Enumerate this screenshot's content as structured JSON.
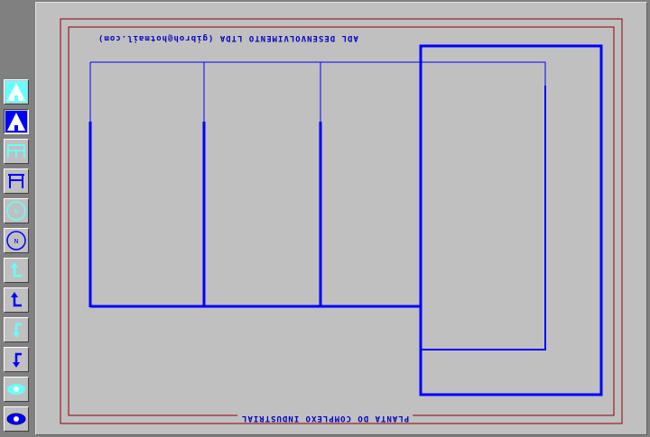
{
  "sheet": {
    "company_text": "ADL DESENVOLVIMENTO LTDA (gibroh@hotmail.com)",
    "title_text": "PLANTA DO COMPLEXO INDUSTRIAL"
  },
  "toolbar": {
    "tools": [
      {
        "name": "triangle-up-light-icon",
        "style": "light"
      },
      {
        "name": "triangle-up-dark-icon",
        "style": "dark"
      },
      {
        "name": "frame-light-icon",
        "style": "light"
      },
      {
        "name": "frame-dark-icon",
        "style": "dark"
      },
      {
        "name": "north-circle-light-icon",
        "style": "light"
      },
      {
        "name": "north-circle-dark-icon",
        "style": "dark"
      },
      {
        "name": "arrow-corner-up-light-icon",
        "style": "light"
      },
      {
        "name": "arrow-corner-up-dark-icon",
        "style": "dark"
      },
      {
        "name": "arrow-corner-down-light-icon",
        "style": "light"
      },
      {
        "name": "arrow-corner-down-dark-icon",
        "style": "dark"
      },
      {
        "name": "eye-light-icon",
        "style": "light"
      },
      {
        "name": "eye-dark-icon",
        "style": "dark"
      }
    ]
  },
  "colors": {
    "line": "#0000ff",
    "border": "#8b0000",
    "light_icon": "#66ffff",
    "dark_icon": "#0000ff"
  }
}
